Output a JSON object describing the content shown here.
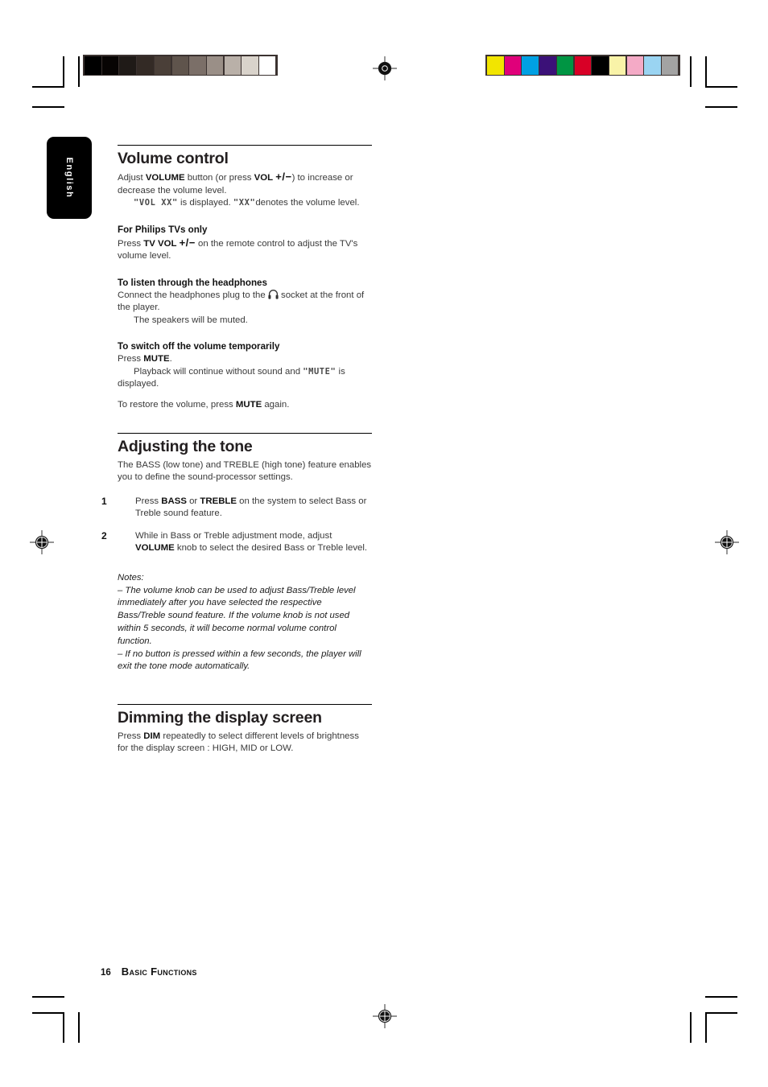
{
  "page": {
    "language_tab": "English",
    "footer": {
      "page_number": "16",
      "title": "Basic Functions"
    }
  },
  "prepress": {
    "grayscale_wedge": [
      "#000000",
      "#070403",
      "#1f1a17",
      "#332a25",
      "#4a3f38",
      "#5f544c",
      "#7b6f68",
      "#9a8f87",
      "#b9b0a8",
      "#d9d3cb",
      "#ffffff"
    ],
    "color_bar": [
      "#f2e500",
      "#e0007a",
      "#00a0e3",
      "#3b1178",
      "#009543",
      "#d80026",
      "#000000",
      "#f9f3a8",
      "#f4aac6",
      "#9ad4f2",
      "#a3a3a3"
    ]
  },
  "sections": [
    {
      "id": "volume-control",
      "heading": "Volume control",
      "intro_a_pre": "Adjust ",
      "intro_a_b1": "VOLUME",
      "intro_a_mid": " button (or press ",
      "intro_a_b2": "VOL",
      "intro_a_pm": "+/−",
      "intro_a_post": ") to increase or decrease the volume level.",
      "intro_b_q1": "\"VOL  XX\"",
      "intro_b_mid": " is displayed. ",
      "intro_b_q2": "\"XX\"",
      "intro_b_post": "denotes the volume level.",
      "subsections": [
        {
          "title": "For Philips TVs only",
          "pre": "Press ",
          "bold": "TV VOL",
          "pm": "+/−",
          "post": " on the remote control to adjust the TV's volume level."
        },
        {
          "title": "To listen through the headphones",
          "pre": "Connect the headphones plug to the ",
          "icon": "headphones-icon",
          "post": " socket at the front of the player.",
          "extra": "The speakers will be muted."
        },
        {
          "title": "To switch off the volume temporarily",
          "pre": "Press ",
          "bold": "MUTE",
          "post": ".",
          "extra_pre": "Playback will continue without sound and ",
          "extra_lcd": "\"MUTE\"",
          "extra_post": " is displayed.",
          "restore_pre": "To restore the volume, press ",
          "restore_bold": "MUTE",
          "restore_post": " again."
        }
      ]
    },
    {
      "id": "adjusting-the-tone",
      "heading": "Adjusting the tone",
      "intro": "The BASS (low tone) and TREBLE (high tone) feature enables you to define the sound-processor settings.",
      "steps": [
        {
          "num": "1",
          "pre": "Press ",
          "b1": "BASS",
          "mid": " or ",
          "b2": "TREBLE",
          "post": " on the system to select Bass or Treble sound feature."
        },
        {
          "num": "2",
          "pre": "While in Bass or Treble adjustment mode, adjust ",
          "b1": "VOLUME",
          "post": " knob to select the desired Bass or Treble level."
        }
      ],
      "notes": {
        "label": "Notes:",
        "items": [
          "–  The volume knob can be used to adjust Bass/Treble level immediately after you have selected the respective Bass/Treble sound feature.  If the volume knob is not used within 5 seconds, it will become normal volume control function.",
          "–  If no button is pressed within a few seconds, the player will exit the tone mode automatically."
        ]
      }
    },
    {
      "id": "dimming-the-display-screen",
      "heading": "Dimming the display screen",
      "pre": "Press ",
      "bold": "DIM",
      "post": " repeatedly to select different levels of brightness for the display screen : HIGH, MID or LOW."
    }
  ]
}
